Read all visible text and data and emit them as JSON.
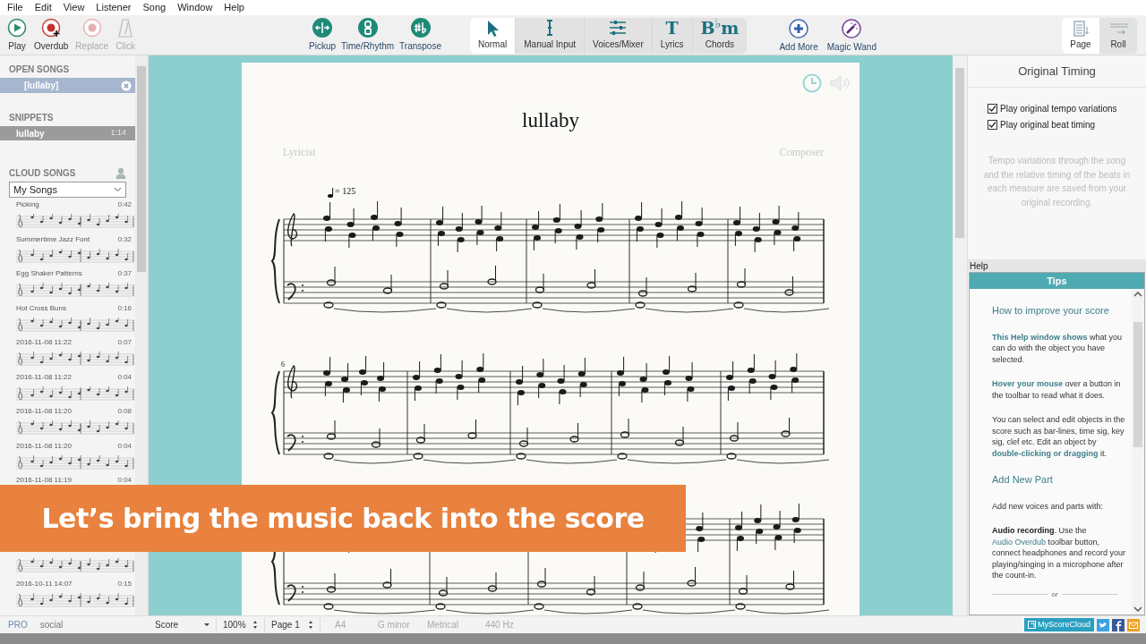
{
  "menu": [
    "File",
    "Edit",
    "View",
    "Listener",
    "Song",
    "Window",
    "Help"
  ],
  "toolbar": {
    "transport": [
      {
        "label": "Play",
        "disabled": false
      },
      {
        "label": "Overdub",
        "disabled": false
      },
      {
        "label": "Replace",
        "disabled": true
      },
      {
        "label": "Click",
        "disabled": true
      }
    ],
    "score_tools": [
      "Pickup",
      "Time/Rhythm",
      "Transpose"
    ],
    "modes": [
      {
        "label": "Normal",
        "selected": true
      },
      {
        "label": "Manual Input",
        "selected": false
      },
      {
        "label": "Voices/Mixer",
        "selected": false
      },
      {
        "label": "Lyrics",
        "glyph": "T",
        "selected": false
      },
      {
        "label": "Chords",
        "glyph": "B$^{♭}$m",
        "selected": false
      }
    ],
    "extras": [
      "Add More",
      "Magic Wand"
    ],
    "views": [
      {
        "label": "Page",
        "selected": true
      },
      {
        "label": "Roll",
        "selected": false
      }
    ]
  },
  "sidebar": {
    "open_songs": {
      "heading": "OPEN SONGS",
      "items": [
        {
          "title": "[lullaby]",
          "selected": true
        }
      ]
    },
    "snippets": {
      "heading": "SNIPPETS",
      "items": [
        {
          "title": "lullaby",
          "duration": "1:14",
          "selected": true
        }
      ]
    },
    "cloud_songs": {
      "heading": "CLOUD SONGS",
      "filter": "My Songs",
      "items": [
        {
          "title": "Picking",
          "duration": "0:42",
          "snippet": true
        },
        {
          "title": "Summertime Jazz Font",
          "duration": "0:32",
          "snippet": true
        },
        {
          "title": "Egg Shaker Patterns",
          "duration": "0:37",
          "snippet": true
        },
        {
          "title": "Hot Cross Buns",
          "duration": "0:16",
          "snippet": true
        },
        {
          "title": "2016-11-08 11:22",
          "duration": "0:07",
          "snippet": true
        },
        {
          "title": "2016-11-08 11:22",
          "duration": "0:04",
          "snippet": true
        },
        {
          "title": "2016-11-08 11:20",
          "duration": "0:08",
          "snippet": true
        },
        {
          "title": "2016-11-08 11:20",
          "duration": "0:04",
          "snippet": true
        },
        {
          "title": "2016-11-08 11:19",
          "duration": "0:04"
        },
        {
          "snippet": true
        },
        {
          "title": "2016-10-11 14:07",
          "duration": "0:15",
          "snippet": true
        }
      ]
    },
    "footer": [
      "PRO",
      "social"
    ]
  },
  "score": {
    "title": "lullaby",
    "lyricist": "Lyricist",
    "composer": "Composer",
    "tempo": "= 125",
    "measure_number": "6"
  },
  "timing_panel": {
    "title": "Original Timing",
    "options": [
      {
        "label": "Play original tempo variations",
        "checked": true
      },
      {
        "label": "Play original beat timing",
        "checked": true
      }
    ],
    "description": "Tempo variations through the song and the relative timing of the beats in each measure are saved from your original recording."
  },
  "help": {
    "label": "Help",
    "tab": "Tips",
    "items": [
      {
        "kind": "heading",
        "text": "How to improve your score"
      },
      {
        "kind": "paragraph",
        "parts": [
          {
            "kind": "accent",
            "text": "This Help window shows"
          },
          {
            "kind": "plain",
            "text": " what you can do with the object you have selected."
          }
        ]
      },
      {
        "kind": "paragraph",
        "parts": [
          {
            "kind": "accent",
            "text": "Hover your mouse"
          },
          {
            "kind": "plain",
            "text": " over a button in the toolbar to read what it does."
          }
        ]
      },
      {
        "kind": "paragraph",
        "parts": [
          {
            "kind": "plain",
            "text": "You can select and edit objects in the score such as bar-lines, time sig, key sig, clef etc. Edit an object by "
          },
          {
            "kind": "accent",
            "text": "double-clicking or dragging"
          },
          {
            "kind": "plain",
            "text": " it."
          }
        ]
      },
      {
        "kind": "heading",
        "text": "Add New Part"
      },
      {
        "kind": "paragraph",
        "parts": [
          {
            "kind": "plain",
            "text": "Add new voices and parts with:"
          }
        ]
      },
      {
        "kind": "paragraph",
        "parts": [
          {
            "kind": "strong",
            "text": "Audio recording"
          },
          {
            "kind": "plain",
            "text": ". Use the "
          },
          {
            "kind": "link",
            "text": "Audio Overdub"
          },
          {
            "kind": "plain",
            "text": " toolbar button, connect headphones and record your playing/singing in a microphone after the count-in."
          }
        ]
      },
      {
        "kind": "divider",
        "text": "or"
      }
    ]
  },
  "status_bar": {
    "view": "Score",
    "zoom": "100%",
    "page": "Page 1",
    "paper": "A4",
    "key": "G minor",
    "timing": "Metrical",
    "tuning": "440 Hz",
    "cloud_button": "MyScoreCloud"
  },
  "caption": "Let’s bring the music back into the score"
}
